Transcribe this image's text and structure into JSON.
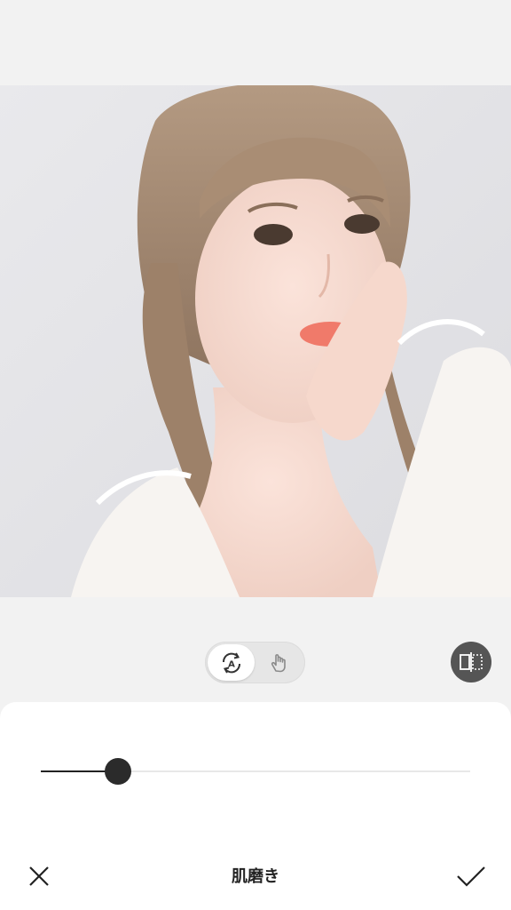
{
  "editor": {
    "tool_title": "肌磨き"
  },
  "mode_toggle": {
    "options": [
      {
        "icon": "auto-adjust-icon",
        "selected": true
      },
      {
        "icon": "manual-hand-icon",
        "selected": false
      }
    ]
  },
  "compare": {
    "icon": "compare-split-icon"
  },
  "slider": {
    "value": 0.18
  },
  "bottom_bar": {
    "cancel_icon": "close-icon",
    "confirm_icon": "checkmark-icon"
  },
  "colors": {
    "background": "#f2f2f2",
    "panel": "#ffffff",
    "slider_active": "#222222",
    "slider_inactive": "#e8e8e8",
    "compare_button": "#555555"
  }
}
